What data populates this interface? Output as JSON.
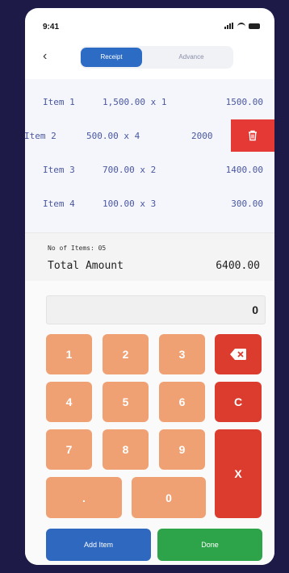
{
  "status": {
    "time": "9:41"
  },
  "nav": {
    "back": "‹",
    "tabs": [
      "Receipt",
      "Advance"
    ]
  },
  "items": [
    {
      "name": "Item 1",
      "calc": "1,500.00 x 1",
      "total": "1500.00"
    },
    {
      "name": "Item 2",
      "calc": "500.00 x 4",
      "total": "2000"
    },
    {
      "name": "Item 3",
      "calc": "700.00 x 2",
      "total": "1400.00"
    },
    {
      "name": "Item 4",
      "calc": "100.00 x 3",
      "total": "300.00"
    }
  ],
  "summary": {
    "count_label": "No of Items: 05",
    "total_label": "Total Amount",
    "total_value": "6400.00"
  },
  "display": {
    "value": "0"
  },
  "keys": {
    "k1": "1",
    "k2": "2",
    "k3": "3",
    "k4": "4",
    "k5": "5",
    "k6": "6",
    "k7": "7",
    "k8": "8",
    "k9": "9",
    "dot": ".",
    "k0": "0",
    "clear": "C",
    "cancel": "X"
  },
  "actions": {
    "add": "Add Item",
    "done": "Done"
  }
}
